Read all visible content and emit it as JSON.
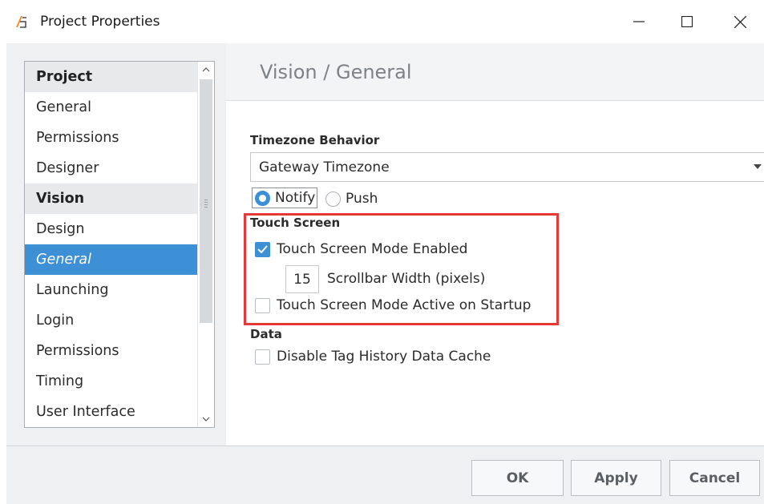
{
  "window": {
    "title": "Project Properties",
    "icon": "ignition-app-icon"
  },
  "sidebar": {
    "items": [
      {
        "label": "Project",
        "kind": "header"
      },
      {
        "label": "General",
        "kind": "item"
      },
      {
        "label": "Permissions",
        "kind": "item"
      },
      {
        "label": "Designer",
        "kind": "item"
      },
      {
        "label": "Vision",
        "kind": "header"
      },
      {
        "label": "Design",
        "kind": "item"
      },
      {
        "label": "General",
        "kind": "selected"
      },
      {
        "label": "Launching",
        "kind": "item"
      },
      {
        "label": "Login",
        "kind": "item"
      },
      {
        "label": "Permissions",
        "kind": "item"
      },
      {
        "label": "Timing",
        "kind": "item"
      },
      {
        "label": "User Interface",
        "kind": "item"
      }
    ]
  },
  "main": {
    "title": "Vision / General",
    "timezone": {
      "label": "Timezone Behavior",
      "selected": "Gateway Timezone",
      "radios": [
        {
          "label": "Notify",
          "checked": true
        },
        {
          "label": "Push",
          "checked": false
        }
      ]
    },
    "touch": {
      "label": "Touch Screen",
      "mode_enabled": {
        "label": "Touch Screen Mode Enabled",
        "checked": true
      },
      "scrollbar_width": {
        "value": "15",
        "label": "Scrollbar Width (pixels)"
      },
      "active_on_startup": {
        "label": "Touch Screen Mode Active on Startup",
        "checked": false
      }
    },
    "data": {
      "label": "Data",
      "disable_cache": {
        "label": "Disable Tag History Data Cache",
        "checked": false
      }
    }
  },
  "footer": {
    "ok_label": "OK",
    "apply_label": "Apply",
    "cancel_label": "Cancel"
  },
  "colors": {
    "accent": "#3d8fd6",
    "highlight": "#e53935"
  }
}
